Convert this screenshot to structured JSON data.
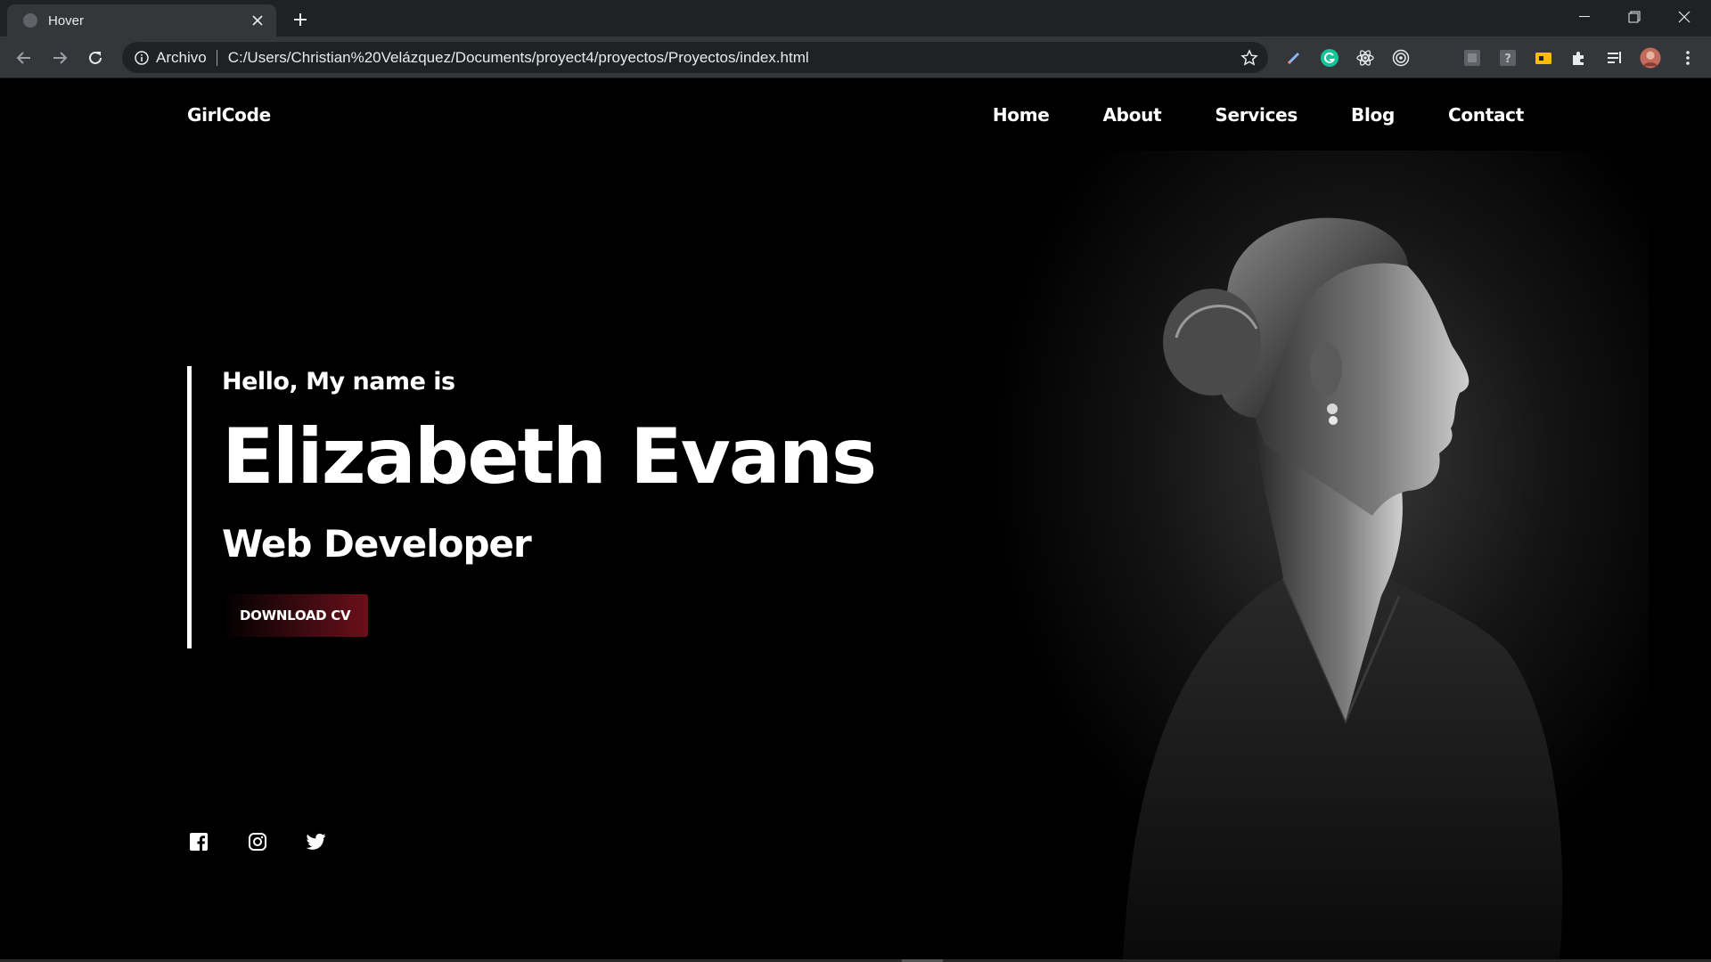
{
  "browser": {
    "tab_title": "Hover",
    "site_label": "Archivo",
    "url": "C:/Users/Christian%20Velázquez/Documents/proyect4/proyectos/Proyectos/index.html"
  },
  "site": {
    "logo": "GirlCode",
    "nav": [
      "Home",
      "About",
      "Services",
      "Blog",
      "Contact"
    ]
  },
  "hero": {
    "greeting": "Hello, My name is",
    "name": "Elizabeth Evans",
    "role": "Web Developer",
    "cta": "DOWNLOAD CV"
  },
  "social": [
    "facebook-icon",
    "instagram-icon",
    "twitter-icon"
  ],
  "colors": {
    "background": "#000000",
    "text": "#ffffff",
    "cta_accent": "#6b0f1a",
    "chrome_dark": "#202124",
    "chrome_toolbar": "#35363a"
  }
}
